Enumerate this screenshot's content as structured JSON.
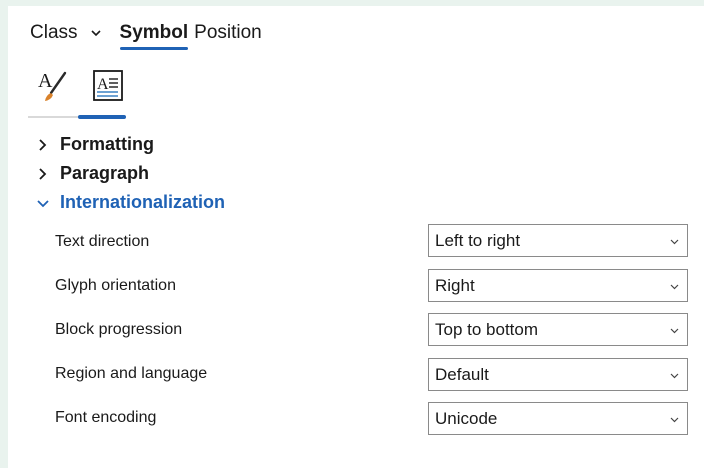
{
  "tabs": {
    "class_label": "Class",
    "symbol_label": "Symbol",
    "position_label": "Position"
  },
  "icon_tabs": [
    {
      "icon": "text-brush-icon",
      "active": false
    },
    {
      "icon": "document-text-icon",
      "active": true
    }
  ],
  "sections": [
    {
      "label": "Formatting",
      "expanded": false
    },
    {
      "label": "Paragraph",
      "expanded": false
    },
    {
      "label": "Internationalization",
      "expanded": true
    }
  ],
  "properties": [
    {
      "label": "Text direction",
      "value": "Left to right"
    },
    {
      "label": "Glyph orientation",
      "value": "Right"
    },
    {
      "label": "Block progression",
      "value": "Top to bottom"
    },
    {
      "label": "Region and language",
      "value": "Default"
    },
    {
      "label": "Font encoding",
      "value": "Unicode"
    }
  ],
  "colors": {
    "accent": "#1f62b5",
    "background": "#e9f3ee",
    "panel": "#ffffff"
  }
}
